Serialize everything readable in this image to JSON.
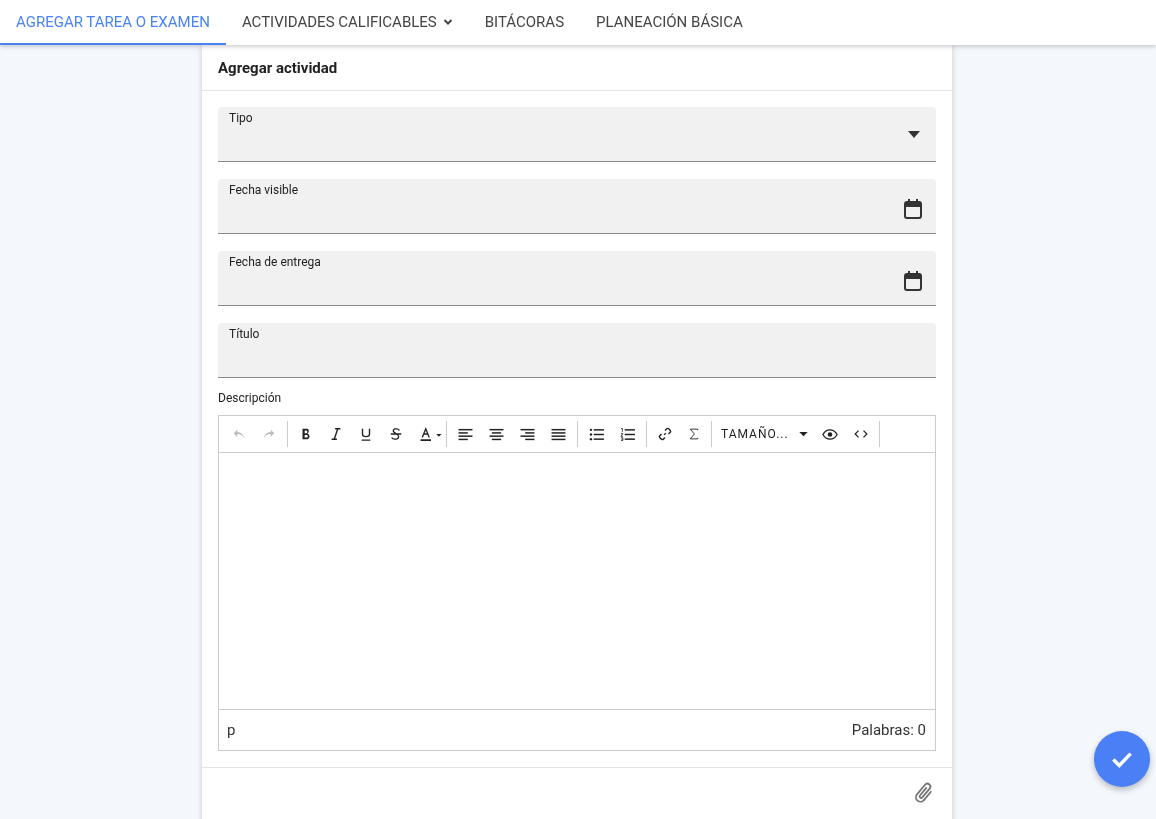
{
  "tabs": [
    {
      "label": "AGREGAR TAREA O EXAMEN",
      "selected": true,
      "has_menu": false
    },
    {
      "label": "ACTIVIDADES CALIFICABLES",
      "selected": false,
      "has_menu": true
    },
    {
      "label": "BITÁCORAS",
      "selected": false,
      "has_menu": false
    },
    {
      "label": "PLANEACIÓN BÁSICA",
      "selected": false,
      "has_menu": false
    }
  ],
  "card": {
    "title": "Agregar actividad",
    "fields": [
      {
        "label": "Tipo",
        "kind": "select"
      },
      {
        "label": "Fecha visible",
        "kind": "date"
      },
      {
        "label": "Fecha de entrega",
        "kind": "date"
      },
      {
        "label": "Título",
        "kind": "text"
      }
    ],
    "editor": {
      "label": "Descripción",
      "history_disabled": true,
      "font_size": "TAMAÑO...",
      "path": "p",
      "word_count": "Palabras: 0"
    }
  }
}
